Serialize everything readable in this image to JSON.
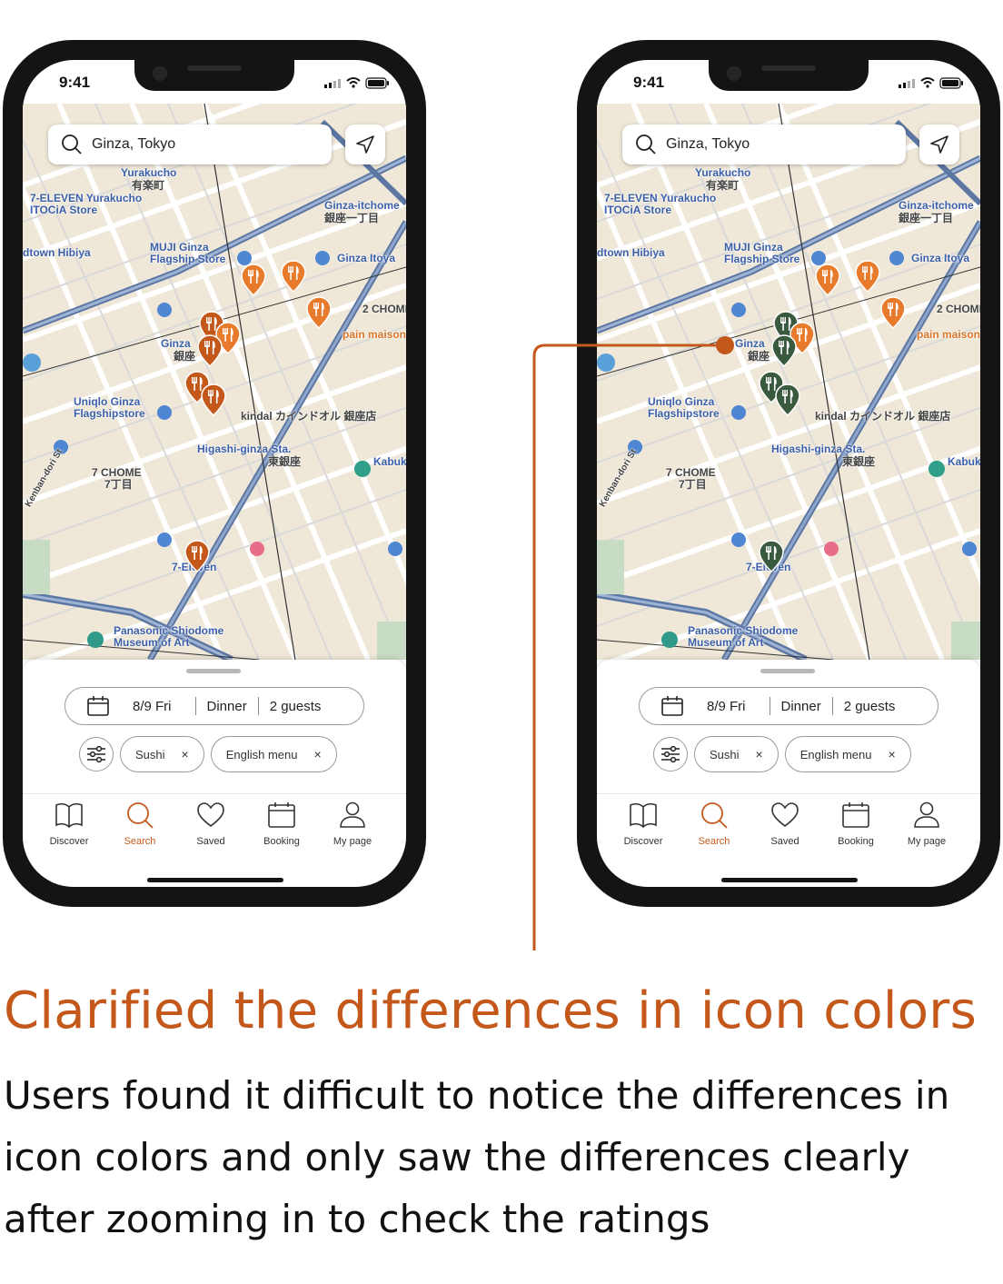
{
  "status": {
    "time": "9:41"
  },
  "search": {
    "location": "Ginza, Tokyo"
  },
  "map_labels": {
    "yurakucho": "Yurakucho",
    "yurakucho_jp": "有楽町",
    "seven_eleven_itocia": "7-ELEVEN Yurakucho ITOCiA Store",
    "ginza_itchome": "Ginza-itchome",
    "ginza_itchome_jp": "銀座一丁目",
    "muji": "MUJI Ginza Flagship Store",
    "ginza_itoya": "Ginza Itoya",
    "hibiya": "dtown Hibiya",
    "ginza": "Ginza",
    "ginza_jp": "銀座",
    "two_chome": "2 CHOME",
    "pain_maison": "pain maison",
    "uniqlo": "Uniqlo Ginza Flagshipstore",
    "kindal": "kindal カインドオル 銀座店",
    "higashi_ginza": "Higashi-ginza Sta.",
    "higashi_ginza_jp": "東銀座",
    "kabuki": "Kabuk",
    "seven_chome": "7 CHOME",
    "seven_chome_jp": "7丁目",
    "seven_eleven_2": "7-Eleven",
    "panasonic": "Panasonic Shiodome Museum of Art",
    "kenban": "Kenban-dori St"
  },
  "booking": {
    "date": "8/9 Fri",
    "meal": "Dinner",
    "guests": "2 guests"
  },
  "filters": [
    {
      "label": "Sushi",
      "remove": "×"
    },
    {
      "label": "English menu",
      "remove": "×"
    }
  ],
  "tabs": [
    {
      "label": "Discover",
      "icon": "book-icon"
    },
    {
      "label": "Search",
      "icon": "search-icon",
      "active": true
    },
    {
      "label": "Saved",
      "icon": "heart-icon"
    },
    {
      "label": "Booking",
      "icon": "calendar-icon"
    },
    {
      "label": "My page",
      "icon": "person-icon"
    }
  ],
  "colors": {
    "accent": "#c4581a",
    "pin_orange": "#e87a2c",
    "pin_dark_orange": "#c4581a",
    "pin_green": "#3a5a40"
  },
  "caption": {
    "headline": "Clarified the differences in icon colors",
    "body": "Users found it difficult to notice the differences in icon colors and only saw the differences clearly after zooming in to check the ratings"
  }
}
